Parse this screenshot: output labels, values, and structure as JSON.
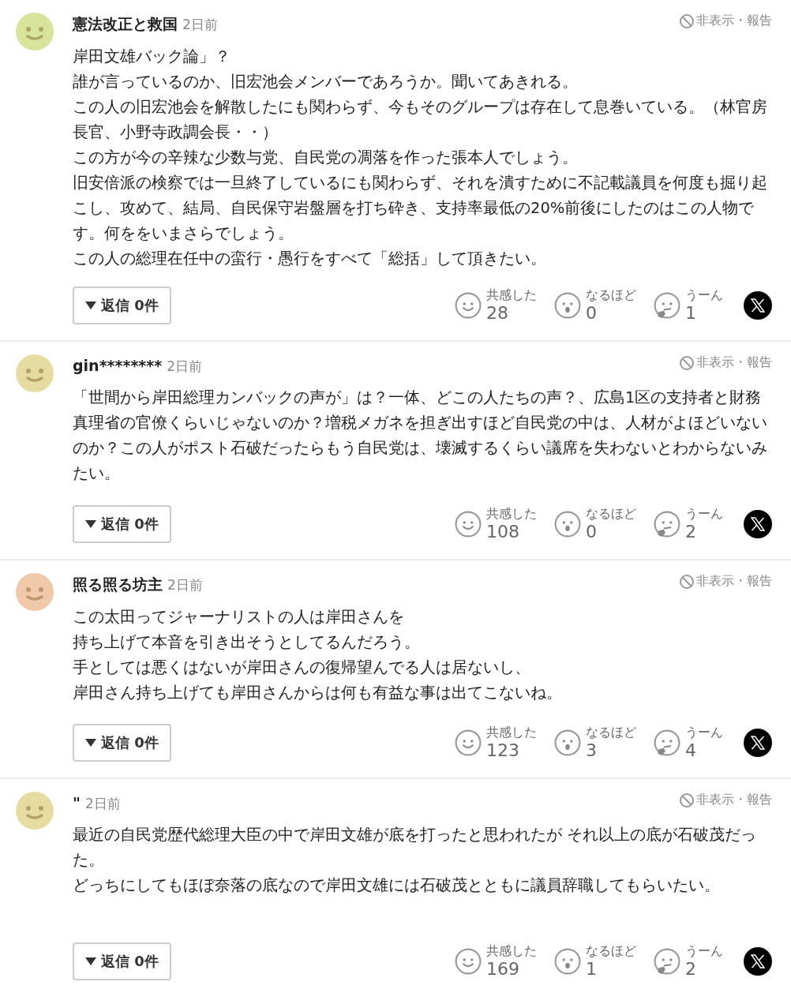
{
  "comments": [
    {
      "color": "#d8e39c",
      "name": "憲法改正と救国",
      "time": "2日前",
      "hide_report": "非表示・報告",
      "lines": [
        "岸田文雄バック論」？",
        "誰が言っているのか、旧宏池会メンバーであろうか。聞いてあきれる。",
        "この人の旧宏池会を解散したにも関わらず、今もそのグループは存在して息巻いている。（林官房長官、小野寺政調会長・・）",
        "この方が今の辛辣な少数与党、自民党の凋落を作った張本人でしょう。",
        "旧安倍派の検察では一旦終了しているにも関わらず、それを潰すために不記載議員を何度も掘り起こし、攻めて、結局、自民保守岩盤層を打ち砕き、支持率最低の20%前後にしたのはこの人物です。何ををいまさらでしょう。",
        "この人の総理在任中の蛮行・愚行をすべて「総括」して頂きたい。"
      ],
      "replies": "返信 0件",
      "reactions": [
        {
          "kind": "smile",
          "label": "共感した",
          "count": "28"
        },
        {
          "kind": "surprise",
          "label": "なるほど",
          "count": "0"
        },
        {
          "kind": "think",
          "label": "うーん",
          "count": "1"
        }
      ]
    },
    {
      "color": "#e6dba0",
      "name": "gin********",
      "time": "2日前",
      "hide_report": "非表示・報告",
      "lines": [
        "「世間から岸田総理カンバックの声が」は？一体、どこの人たちの声？、広島1区の支持者と財務真理省の官僚くらいじゃないのか？増税メガネを担ぎ出すほど自民党の中は、人材がよほどいないのか？この人がポスト石破だったらもう自民党は、壊滅するくらい議席を失わないとわからないみたい。"
      ],
      "replies": "返信 0件",
      "reactions": [
        {
          "kind": "smile",
          "label": "共感した",
          "count": "108"
        },
        {
          "kind": "surprise",
          "label": "なるほど",
          "count": "0"
        },
        {
          "kind": "think",
          "label": "うーん",
          "count": "2"
        }
      ]
    },
    {
      "color": "#f0c9ab",
      "name": "照る照る坊主",
      "time": "2日前",
      "hide_report": "非表示・報告",
      "lines": [
        "この太田ってジャーナリストの人は岸田さんを",
        "持ち上げて本音を引き出そうとしてるんだろう。",
        "手としては悪くはないが岸田さんの復帰望んでる人は居ないし、",
        "岸田さん持ち上げても岸田さんからは何も有益な事は出てこないね。"
      ],
      "replies": "返信 0件",
      "reactions": [
        {
          "kind": "smile",
          "label": "共感した",
          "count": "123"
        },
        {
          "kind": "surprise",
          "label": "なるほど",
          "count": "3"
        },
        {
          "kind": "think",
          "label": "うーん",
          "count": "4"
        }
      ]
    },
    {
      "color": "#e6dba0",
      "name": "\"",
      "time": "2日前",
      "hide_report": "非表示・報告",
      "lines": [
        "最近の自民党歴代総理大臣の中で岸田文雄が底を打ったと思われたが それ以上の底が石破茂だった。",
        "どっちにしてもほぼ奈落の底なので岸田文雄には石破茂とともに議員辞職してもらいたい。"
      ],
      "replies": "返信 0件",
      "reactions": [
        {
          "kind": "smile",
          "label": "共感した",
          "count": "169"
        },
        {
          "kind": "surprise",
          "label": "なるほど",
          "count": "1"
        },
        {
          "kind": "think",
          "label": "うーん",
          "count": "2"
        }
      ]
    }
  ]
}
